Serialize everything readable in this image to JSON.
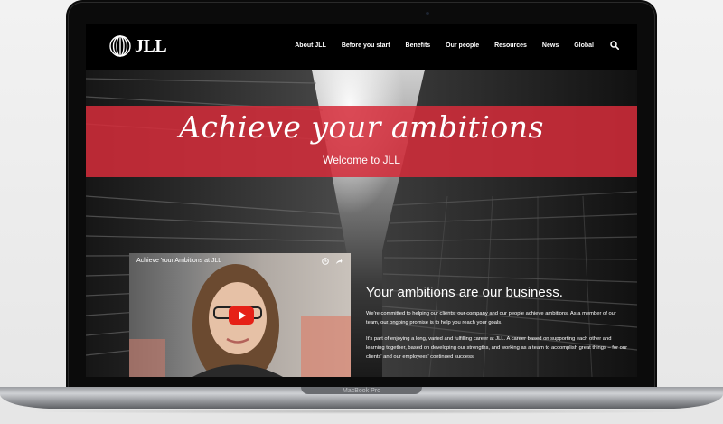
{
  "brand": {
    "name": "JLL"
  },
  "nav": {
    "items": [
      "About JLL",
      "Before you start",
      "Benefits",
      "Our people",
      "Resources",
      "News",
      "Global"
    ],
    "search_icon": "search-icon"
  },
  "hero": {
    "title": "Achieve your ambitions",
    "subtitle": "Welcome to JLL"
  },
  "video": {
    "title": "Achieve Your Ambitions at JLL",
    "icons": [
      "clock-icon",
      "share-icon",
      "play-icon"
    ]
  },
  "content": {
    "heading": "Your ambitions are our business.",
    "paragraph_1": "We're committed to helping our clients, our company and our people achieve ambitions. As a member of our team, our ongoing promise is to help you reach your goals.",
    "paragraph_2": "It's part of enjoying a long, varied and fulfilling career at JLL. A career based on supporting each other and learning together, based on developing our strengths, and working as a team to accomplish great things – for our clients' and our employees' continued success."
  },
  "device": {
    "label": "MacBook Pro"
  },
  "colors": {
    "accent": "#d52c3a",
    "nav_bg": "#000000",
    "play": "#e62117"
  }
}
